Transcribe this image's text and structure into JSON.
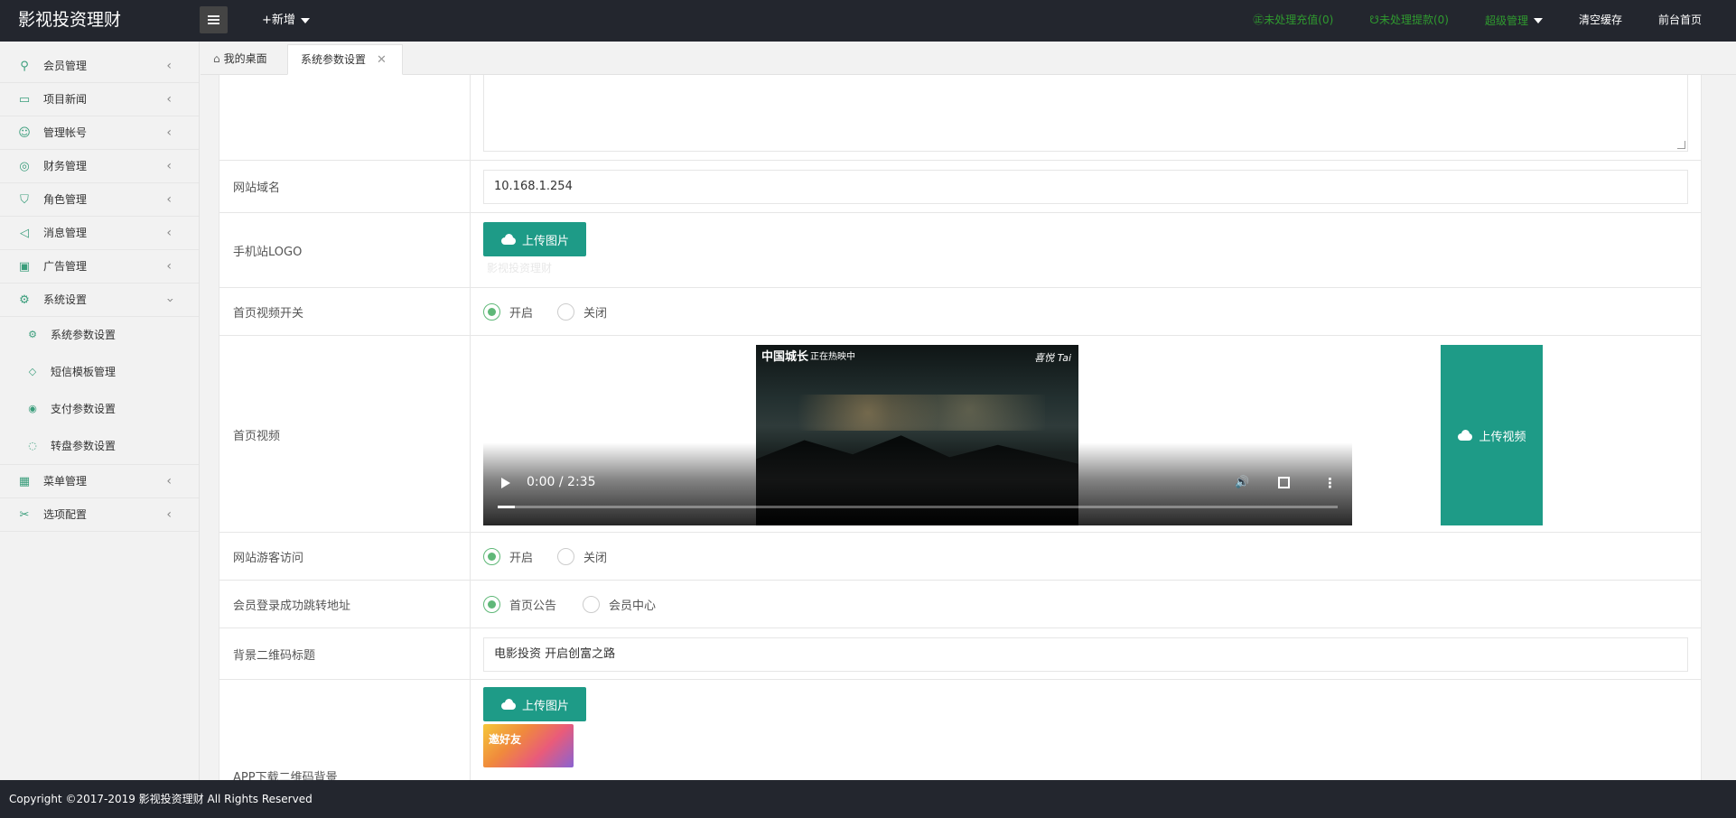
{
  "header": {
    "brand": "影视投资理财",
    "add_new": "+新增",
    "pending_recharge": "㊣未处理充值(0)",
    "pending_withdraw": "☋未处理提款(0)",
    "admin": "超级管理",
    "clear_cache": "清空缓存",
    "frontend_home": "前台首页"
  },
  "sidebar": {
    "items": [
      {
        "label": "会员管理",
        "icon": "user-icon"
      },
      {
        "label": "项目新闻",
        "icon": "book-icon"
      },
      {
        "label": "管理帐号",
        "icon": "account-icon"
      },
      {
        "label": "财务管理",
        "icon": "finance-icon"
      },
      {
        "label": "角色管理",
        "icon": "shield-icon"
      },
      {
        "label": "消息管理",
        "icon": "speaker-icon"
      },
      {
        "label": "广告管理",
        "icon": "image-icon"
      },
      {
        "label": "系统设置",
        "icon": "gear-icon"
      }
    ],
    "sub_items": [
      {
        "label": "系统参数设置",
        "icon": "gear-icon"
      },
      {
        "label": "短信模板管理",
        "icon": "tag-icon"
      },
      {
        "label": "支付参数设置",
        "icon": "pay-icon"
      },
      {
        "label": "转盘参数设置",
        "icon": "wheel-icon"
      }
    ],
    "tail_items": [
      {
        "label": "菜单管理",
        "icon": "menu-icon"
      },
      {
        "label": "选项配置",
        "icon": "options-icon"
      }
    ]
  },
  "tabs": {
    "home": "我的桌面",
    "active": "系统参数设置"
  },
  "form": {
    "domain_label": "网站域名",
    "domain_value": "10.168.1.254",
    "mobile_logo_label": "手机站LOGO",
    "upload_image": "上传图片",
    "mobile_logo_faint": "影视投资理财",
    "video_switch_label": "首页视频开关",
    "on": "开启",
    "off": "关闭",
    "home_video_label": "首页视频",
    "video_time": "0:00 / 2:35",
    "video_overlay_logo": "中国城长",
    "video_overlay_status": "正在热映中",
    "video_overlay_right": "喜悦 Tai",
    "upload_video": "上传视频",
    "guest_access_label": "网站游客访问",
    "login_redirect_label": "会员登录成功跳转地址",
    "redirect_home": "首页公告",
    "redirect_member": "会员中心",
    "qr_title_label": "背景二维码标题",
    "qr_title_value": "电影投资 开启创富之路",
    "app_qr_bg_label": "APP下载二维码背景",
    "thumb_text": "邀好友"
  },
  "footer": {
    "copyright": "Copyright ©2017-2019 影视投资理财 All Rights Reserved"
  },
  "colors": {
    "header_bg": "#23262e",
    "accent_teal": "#1e9b87",
    "radio_green": "#5fb878",
    "notice_green": "#2f9a2f"
  }
}
